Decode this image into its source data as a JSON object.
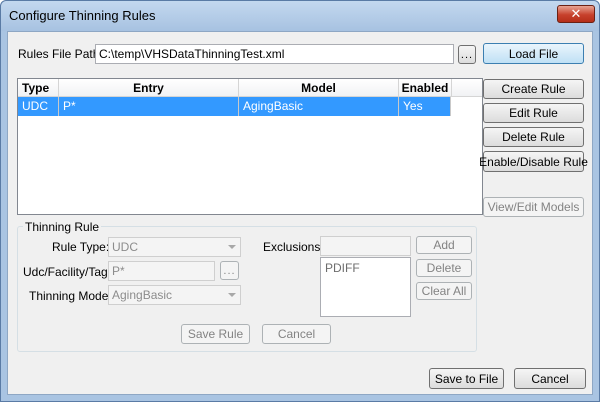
{
  "window": {
    "title": "Configure Thinning Rules",
    "close_label": "✕"
  },
  "file": {
    "label": "Rules File Path:",
    "path": "C:\\temp\\VHSDataThinningTest.xml",
    "browse_label": "...",
    "load_label": "Load File"
  },
  "table": {
    "columns": [
      "Type",
      "Entry",
      "Model",
      "Enabled"
    ],
    "rows": [
      {
        "type": "UDC",
        "entry": "P*",
        "model": "AgingBasic",
        "enabled": "Yes"
      }
    ]
  },
  "rule_actions": {
    "create": "Create Rule",
    "edit": "Edit Rule",
    "delete": "Delete Rule",
    "toggle": "Enable/Disable Rule",
    "view_models": "View/Edit Models"
  },
  "thinning_rule": {
    "group_title": "Thinning Rule",
    "rule_type_label": "Rule Type:",
    "rule_type_value": "UDC",
    "udc_label": "Udc/Facility/Tag:",
    "udc_value": "P*",
    "udc_browse_label": "...",
    "model_label": "Thinning Model:",
    "model_value": "AgingBasic",
    "exclusions_label": "Exclusions:",
    "exclusion_input": "",
    "exclusions": [
      "PDIFF"
    ],
    "add_label": "Add",
    "delete_label": "Delete",
    "clear_label": "Clear All",
    "save_label": "Save Rule",
    "cancel_label": "Cancel"
  },
  "footer": {
    "save_label": "Save to File",
    "cancel_label": "Cancel"
  },
  "colors": {
    "selection": "#3399ff",
    "frame": "#a9c4e2",
    "close": "#c7412c"
  }
}
